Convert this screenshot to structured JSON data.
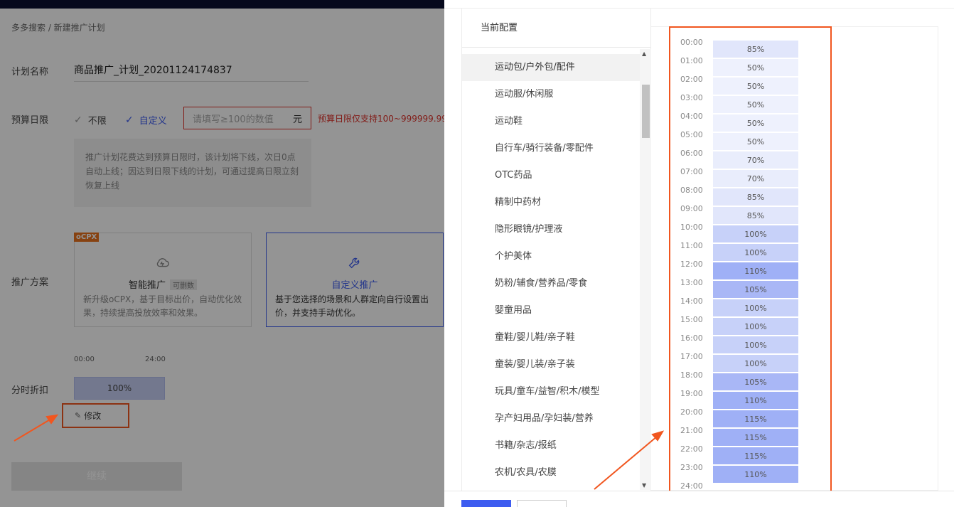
{
  "breadcrumb": "多多搜索 / 新建推广计划",
  "form": {
    "plan_name_label": "计划名称",
    "plan_name_value": "商品推广_计划_20201124174837",
    "budget_label": "预算日限",
    "budget_unlimited": "不限",
    "budget_custom": "自定义",
    "budget_placeholder": "请填写≥100的数值",
    "budget_unit": "元",
    "budget_error": "预算日限仅支持100~999999.99",
    "budget_tip": "推广计划花费达到预算日限时，该计划将下线，次日0点自动上线；因达到日限下线的计划，可通过提高日限立刻恢复上线",
    "scheme_label": "推广方案",
    "ocpx_tag": "oCPX",
    "smart_title": "智能推广",
    "smart_badge": "可删数",
    "smart_desc": "新升级oCPX，基于目标出价，自动优化效果，持续提高投放效率和效果。",
    "custom_title": "自定义推广",
    "custom_desc": "基于您选择的场景和人群定向自行设置出价，并支持手动优化。",
    "time_discount_label": "分时折扣",
    "tick_start": "00:00",
    "tick_end": "24:00",
    "discount_value": "100%",
    "modify_label": "修改",
    "continue_label": "继续"
  },
  "drawer": {
    "current_config": "当前配置",
    "categories": [
      "运动包/户外包/配件",
      "运动服/休闲服",
      "运动鞋",
      "自行车/骑行装备/零配件",
      "OTC药品",
      "精制中药材",
      "隐形眼镜/护理液",
      "个护美体",
      "奶粉/辅食/营养品/零食",
      "婴童用品",
      "童鞋/婴儿鞋/亲子鞋",
      "童装/婴儿装/亲子装",
      "玩具/童车/益智/积木/模型",
      "孕产妇用品/孕妇装/营养",
      "书籍/杂志/报纸",
      "农机/农具/农膜"
    ],
    "selected_index": 0,
    "hours": [
      {
        "time": "00:00",
        "pct": "85%",
        "val": 85
      },
      {
        "time": "01:00",
        "pct": "50%",
        "val": 50
      },
      {
        "time": "02:00",
        "pct": "50%",
        "val": 50
      },
      {
        "time": "03:00",
        "pct": "50%",
        "val": 50
      },
      {
        "time": "04:00",
        "pct": "50%",
        "val": 50
      },
      {
        "time": "05:00",
        "pct": "50%",
        "val": 50
      },
      {
        "time": "06:00",
        "pct": "70%",
        "val": 70
      },
      {
        "time": "07:00",
        "pct": "70%",
        "val": 70
      },
      {
        "time": "08:00",
        "pct": "85%",
        "val": 85
      },
      {
        "time": "09:00",
        "pct": "85%",
        "val": 85
      },
      {
        "time": "10:00",
        "pct": "100%",
        "val": 100
      },
      {
        "time": "11:00",
        "pct": "100%",
        "val": 100
      },
      {
        "time": "12:00",
        "pct": "110%",
        "val": 110
      },
      {
        "time": "13:00",
        "pct": "105%",
        "val": 105
      },
      {
        "time": "14:00",
        "pct": "100%",
        "val": 100
      },
      {
        "time": "15:00",
        "pct": "100%",
        "val": 100
      },
      {
        "time": "16:00",
        "pct": "100%",
        "val": 100
      },
      {
        "time": "17:00",
        "pct": "100%",
        "val": 100
      },
      {
        "time": "18:00",
        "pct": "105%",
        "val": 105
      },
      {
        "time": "19:00",
        "pct": "110%",
        "val": 110
      },
      {
        "time": "20:00",
        "pct": "115%",
        "val": 115
      },
      {
        "time": "21:00",
        "pct": "115%",
        "val": 115
      },
      {
        "time": "22:00",
        "pct": "115%",
        "val": 115
      },
      {
        "time": "23:00",
        "pct": "110%",
        "val": 110
      }
    ],
    "end_time": "24:00"
  },
  "colors": {
    "accent": "#3d5cf0",
    "highlight": "#f1561f",
    "error": "#e0322b"
  }
}
